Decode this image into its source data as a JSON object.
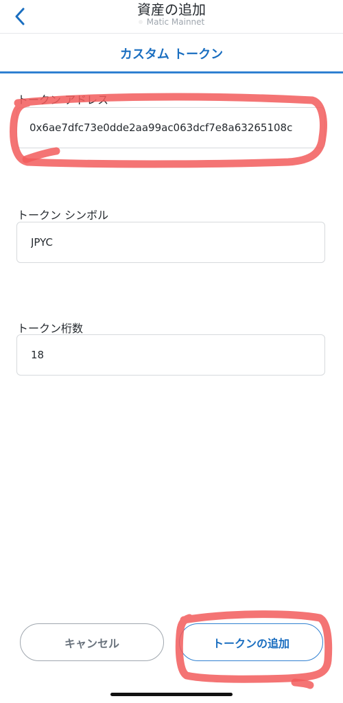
{
  "header": {
    "title": "資産の追加",
    "network": "Matic Mainnet"
  },
  "tab": {
    "label": "カスタム トークン"
  },
  "fields": {
    "address": {
      "label": "トークン アドレス",
      "value": "0x6ae7dfc73e0dde2aa99ac063dcf7e8a63265108c"
    },
    "symbol": {
      "label": "トークン シンボル",
      "value": "JPYC"
    },
    "decimals": {
      "label": "トークン桁数",
      "value": "18"
    }
  },
  "buttons": {
    "cancel": "キャンセル",
    "add": "トークンの追加"
  },
  "colors": {
    "accent": "#1a6ec0",
    "highlight": "#f25c5c"
  },
  "icons": {
    "back": "chevron-left-icon"
  }
}
